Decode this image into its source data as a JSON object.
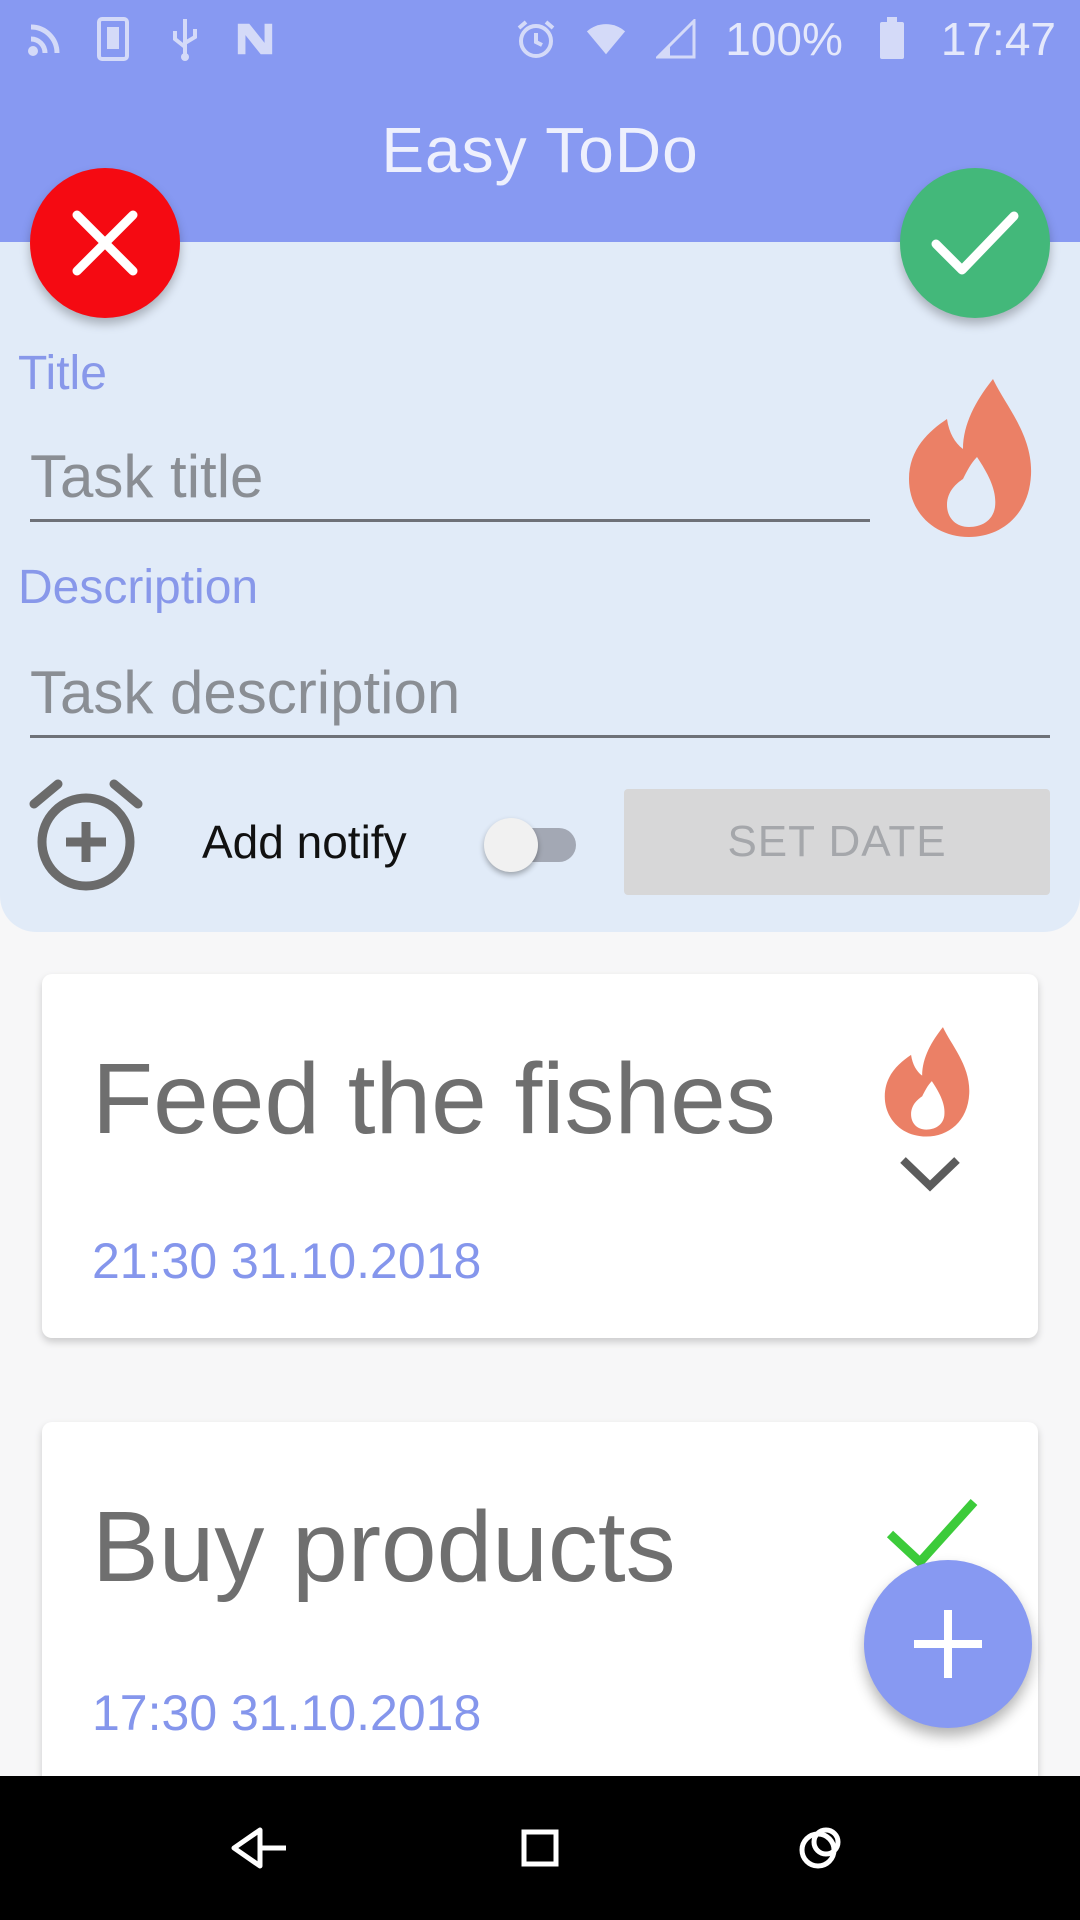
{
  "status_bar": {
    "battery_text": "100%",
    "time": "17:47",
    "left_icons": [
      "rss-icon",
      "phone-icon",
      "usb-icon",
      "n-icon"
    ],
    "right_icons": [
      "alarm-icon",
      "wifi-icon",
      "signal-icon",
      "battery-icon"
    ]
  },
  "app_bar": {
    "title": "Easy ToDo"
  },
  "form": {
    "title_label": "Title",
    "title_placeholder": "Task title",
    "title_value": "",
    "description_label": "Description",
    "description_placeholder": "Task description",
    "description_value": "",
    "notify_label": "Add notify",
    "notify_enabled": false,
    "set_date_label": "SET DATE"
  },
  "tasks": [
    {
      "title": "Feed the fishes",
      "datetime": "21:30 31.10.2018",
      "status_icon": "flame-icon",
      "has_expand": true
    },
    {
      "title": "Buy products",
      "datetime": "17:30 31.10.2018",
      "status_icon": "check-icon",
      "has_expand": false
    }
  ],
  "colors": {
    "primary": "#8799f2",
    "cancel": "#f50a12",
    "confirm": "#43b87a",
    "flame": "#eb8066",
    "done_check": "#3ccb3a",
    "form_background": "#e1ebf8"
  }
}
